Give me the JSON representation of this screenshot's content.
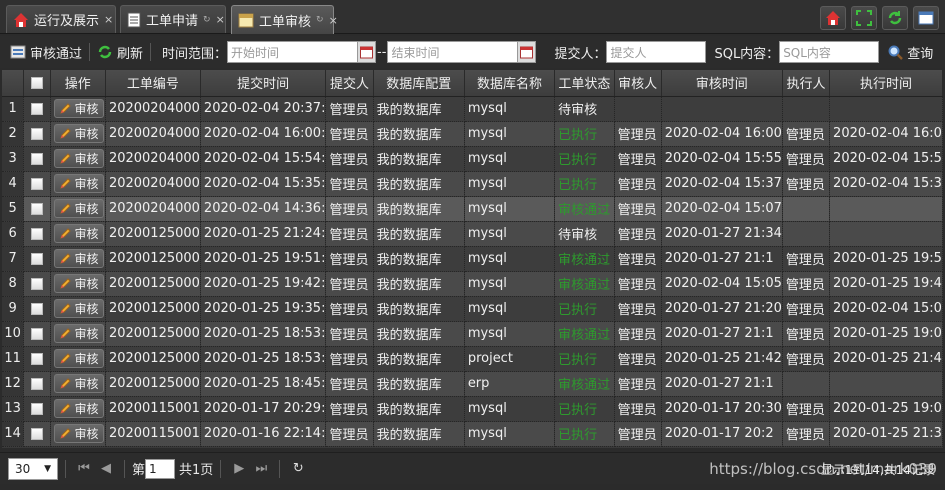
{
  "tabs": [
    {
      "label": "运行及展示",
      "close": "×"
    },
    {
      "label": "工单申请",
      "close": "×"
    },
    {
      "label": "工单审核",
      "close": "×"
    }
  ],
  "toolbar": {
    "approve_label": "审核通过",
    "refresh_label": "刷新",
    "time_range_label": "时间范围：",
    "start_placeholder": "开始时间",
    "range_sep": "--",
    "end_placeholder": "结束时间",
    "submitter_label": "提交人：",
    "submitter_placeholder": "提交人",
    "sql_label": "SQL内容：",
    "sql_placeholder": "SQL内容",
    "search_label": "查询"
  },
  "grid": {
    "columns": [
      "操作",
      "工单编号",
      "提交时间",
      "提交人",
      "数据库配置",
      "数据库名称",
      "工单状态",
      "审核人",
      "审核时间",
      "执行人",
      "执行时间"
    ],
    "action_label": "审核",
    "rows": [
      {
        "no": "1",
        "id": "20200204000",
        "submit_time": "2020-02-04 20:37:",
        "submitter": "管理员",
        "db_config": "我的数据库",
        "db_name": "mysql",
        "status": "待审核",
        "status_green": false,
        "reviewer": "",
        "review_time": "",
        "executor": "",
        "exec_time": ""
      },
      {
        "no": "2",
        "id": "20200204000",
        "submit_time": "2020-02-04 16:00:",
        "submitter": "管理员",
        "db_config": "我的数据库",
        "db_name": "mysql",
        "status": "已执行",
        "status_green": true,
        "reviewer": "管理员",
        "review_time": "2020-02-04 16:00",
        "executor": "管理员",
        "exec_time": "2020-02-04 16:0"
      },
      {
        "no": "3",
        "id": "20200204000",
        "submit_time": "2020-02-04 15:54:",
        "submitter": "管理员",
        "db_config": "我的数据库",
        "db_name": "mysql",
        "status": "已执行",
        "status_green": true,
        "reviewer": "管理员",
        "review_time": "2020-02-04 15:55",
        "executor": "管理员",
        "exec_time": "2020-02-04 15:5"
      },
      {
        "no": "4",
        "id": "20200204000",
        "submit_time": "2020-02-04 15:35:",
        "submitter": "管理员",
        "db_config": "我的数据库",
        "db_name": "mysql",
        "status": "已执行",
        "status_green": true,
        "reviewer": "管理员",
        "review_time": "2020-02-04 15:37",
        "executor": "管理员",
        "exec_time": "2020-02-04 15:3"
      },
      {
        "no": "5",
        "id": "20200204000",
        "submit_time": "2020-02-04 14:36:",
        "submitter": "管理员",
        "db_config": "我的数据库",
        "db_name": "mysql",
        "status": "审核通过",
        "status_green": true,
        "reviewer": "管理员",
        "review_time": "2020-02-04 15:07",
        "executor": "",
        "exec_time": ""
      },
      {
        "no": "6",
        "id": "20200125000",
        "submit_time": "2020-01-25 21:24:",
        "submitter": "管理员",
        "db_config": "我的数据库",
        "db_name": "mysql",
        "status": "待审核",
        "status_green": false,
        "reviewer": "管理员",
        "review_time": "2020-01-27 21:34",
        "executor": "",
        "exec_time": ""
      },
      {
        "no": "7",
        "id": "20200125000",
        "submit_time": "2020-01-25 19:51:",
        "submitter": "管理员",
        "db_config": "我的数据库",
        "db_name": "mysql",
        "status": "审核通过",
        "status_green": true,
        "reviewer": "管理员",
        "review_time": "2020-01-27 21:1",
        "executor": "管理员",
        "exec_time": "2020-01-25 19:5"
      },
      {
        "no": "8",
        "id": "20200125000",
        "submit_time": "2020-01-25 19:42:",
        "submitter": "管理员",
        "db_config": "我的数据库",
        "db_name": "mysql",
        "status": "审核通过",
        "status_green": true,
        "reviewer": "管理员",
        "review_time": "2020-02-04 15:05",
        "executor": "管理员",
        "exec_time": "2020-01-25 19:4"
      },
      {
        "no": "9",
        "id": "20200125000",
        "submit_time": "2020-01-25 19:35:",
        "submitter": "管理员",
        "db_config": "我的数据库",
        "db_name": "mysql",
        "status": "已执行",
        "status_green": true,
        "reviewer": "管理员",
        "review_time": "2020-01-27 21:20",
        "executor": "管理员",
        "exec_time": "2020-02-04 15:0"
      },
      {
        "no": "10",
        "id": "20200125000",
        "submit_time": "2020-01-25 18:53:",
        "submitter": "管理员",
        "db_config": "我的数据库",
        "db_name": "mysql",
        "status": "审核通过",
        "status_green": true,
        "reviewer": "管理员",
        "review_time": "2020-01-27 21:1",
        "executor": "管理员",
        "exec_time": "2020-01-25 19:0"
      },
      {
        "no": "11",
        "id": "20200125000",
        "submit_time": "2020-01-25 18:53:",
        "submitter": "管理员",
        "db_config": "我的数据库",
        "db_name": "project",
        "status": "已执行",
        "status_green": true,
        "reviewer": "管理员",
        "review_time": "2020-01-25 21:42",
        "executor": "管理员",
        "exec_time": "2020-01-25 21:4"
      },
      {
        "no": "12",
        "id": "20200125000",
        "submit_time": "2020-01-25 18:45:",
        "submitter": "管理员",
        "db_config": "我的数据库",
        "db_name": "erp",
        "status": "审核通过",
        "status_green": true,
        "reviewer": "管理员",
        "review_time": "2020-01-27 21:1",
        "executor": "",
        "exec_time": ""
      },
      {
        "no": "13",
        "id": "20200115001",
        "submit_time": "2020-01-17 20:29:",
        "submitter": "管理员",
        "db_config": "我的数据库",
        "db_name": "mysql",
        "status": "已执行",
        "status_green": true,
        "reviewer": "管理员",
        "review_time": "2020-01-17 20:30",
        "executor": "管理员",
        "exec_time": "2020-01-25 19:0"
      },
      {
        "no": "14",
        "id": "20200115001",
        "submit_time": "2020-01-16 22:14:",
        "submitter": "管理员",
        "db_config": "我的数据库",
        "db_name": "mysql",
        "status": "已执行",
        "status_green": true,
        "reviewer": "管理员",
        "review_time": "2020-01-17 20:2",
        "executor": "管理员",
        "exec_time": "2020-01-25 21:3"
      }
    ]
  },
  "pager": {
    "page_size": "30",
    "page_prefix": "第",
    "page_value": "1",
    "page_suffix": "共1页",
    "info": "显示1到14,共14记录"
  },
  "watermark": "https://blog.csdn.net/mark039"
}
